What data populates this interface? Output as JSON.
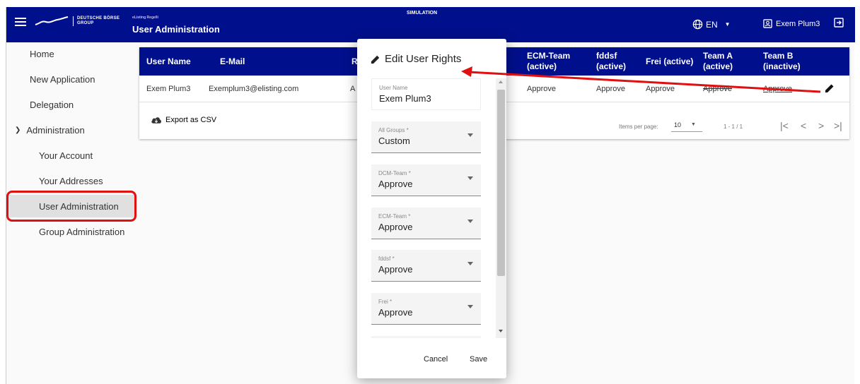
{
  "header": {
    "logo_line1": "DEUTSCHE BÖRSE",
    "logo_line2": "GROUP",
    "app_subtitle": "eListing Regelli",
    "app_title": "User Administration",
    "simulation": "SIMULATION",
    "language": "EN",
    "user_name": "Exem Plum3"
  },
  "sidebar": {
    "items": [
      {
        "label": "Home"
      },
      {
        "label": "New Application"
      },
      {
        "label": "Delegation"
      },
      {
        "label": "Administration"
      },
      {
        "label": "Your Account"
      },
      {
        "label": "Your Addresses"
      },
      {
        "label": "User Administration"
      },
      {
        "label": "Group Administration"
      }
    ]
  },
  "table": {
    "columns": [
      "User Name",
      "E-Mail",
      "R",
      "ECM-Team\n(active)",
      "fddsf\n(active)",
      "Frei (active)",
      "Team A\n(active)",
      "Team B\n(inactive)"
    ],
    "row": {
      "user_name": "Exem Plum3",
      "email": "Exemplum3@elisting.com",
      "col3": "A",
      "ecm": "Approve",
      "fddsf": "Approve",
      "frei": "Approve",
      "team_a": "Approve",
      "team_b": "Approve"
    },
    "export_label": "Export as CSV",
    "items_per_page_label": "Items per page:",
    "items_per_page": "10",
    "range": "1 - 1 / 1"
  },
  "dialog": {
    "title": "Edit User Rights",
    "fields": [
      {
        "label": "User Name",
        "value": "Exem Plum3"
      },
      {
        "label": "All Groups *",
        "value": "Custom"
      },
      {
        "label": "DCM-Team *",
        "value": "Approve"
      },
      {
        "label": "ECM-Team *",
        "value": "Approve"
      },
      {
        "label": "fddsf *",
        "value": "Approve"
      },
      {
        "label": "Frei *",
        "value": "Approve"
      }
    ],
    "cancel": "Cancel",
    "save": "Save"
  },
  "colors": {
    "primary": "#000f8c",
    "highlight": "#e01010"
  }
}
